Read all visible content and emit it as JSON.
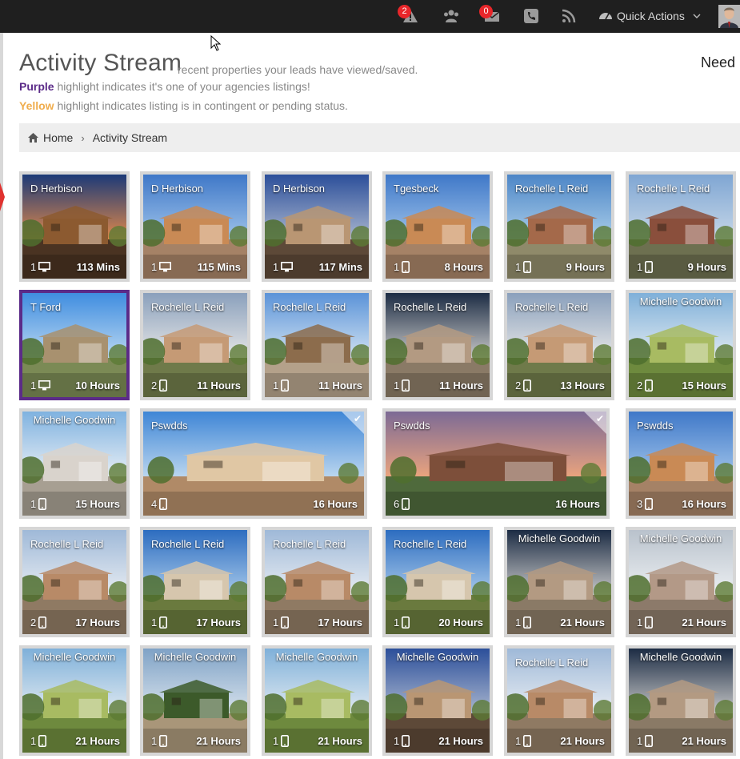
{
  "topbar": {
    "alerts_count": "2",
    "messages_count": "0",
    "quick_actions_label": "Quick Actions"
  },
  "header": {
    "title": "Activity Stream",
    "subtitle": "recent properties your leads have viewed/saved.",
    "need_label": "Need",
    "legend_purple_word": "Purple",
    "legend_purple_text": " highlight indicates it's one of your agencies listings!",
    "legend_yellow_word": "Yellow",
    "legend_yellow_text": " highlight indicates listing is in contingent or pending status.",
    "purple_color": "#5b2b88",
    "yellow_color": "#f0ad4e"
  },
  "breadcrumb": {
    "home": "Home",
    "current": "Activity Stream"
  },
  "tiles": [
    {
      "lead": "D Herbison",
      "count": "1",
      "device": "desktop-icon",
      "ago": "113 Mins",
      "scene": "dusk"
    },
    {
      "lead": "D Herbison",
      "count": "1",
      "device": "desktop-icon",
      "ago": "115 Mins",
      "scene": "adobe"
    },
    {
      "lead": "D Herbison",
      "count": "1",
      "device": "desktop-icon",
      "ago": "117 Mins",
      "scene": "dusk2"
    },
    {
      "lead": "Tgesbeck",
      "count": "1",
      "device": "mobile-icon",
      "ago": "8 Hours",
      "scene": "adobe"
    },
    {
      "lead": "Rochelle L Reid",
      "count": "1",
      "device": "mobile-icon",
      "ago": "9 Hours",
      "scene": "desert"
    },
    {
      "lead": "Rochelle L Reid",
      "count": "1",
      "device": "mobile-icon",
      "ago": "9 Hours",
      "scene": "brick"
    },
    {
      "lead": "T Ford",
      "count": "1",
      "device": "desktop-icon",
      "ago": "10 Hours",
      "scene": "aerial",
      "agency": true
    },
    {
      "lead": "Rochelle L Reid",
      "count": "2",
      "device": "mobile-icon",
      "ago": "11 Hours",
      "scene": "cloudy"
    },
    {
      "lead": "Rochelle L Reid",
      "count": "1",
      "device": "mobile-icon",
      "ago": "11 Hours",
      "scene": "patio"
    },
    {
      "lead": "Rochelle L Reid",
      "count": "1",
      "device": "mobile-icon",
      "ago": "11 Hours",
      "scene": "garage"
    },
    {
      "lead": "Rochelle L Reid",
      "count": "2",
      "device": "mobile-icon",
      "ago": "13 Hours",
      "scene": "cloudy"
    },
    {
      "lead": "Michelle Goodwin",
      "count": "2",
      "device": "mobile-icon",
      "ago": "15 Hours",
      "scene": "trees"
    },
    {
      "lead": "Michelle Goodwin",
      "count": "1",
      "device": "mobile-icon",
      "ago": "15 Hours",
      "scene": "modern"
    },
    {
      "lead": "Pswdds",
      "count": "4",
      "device": "mobile-icon",
      "ago": "16 Hours",
      "scene": "stucco",
      "wide": true,
      "saved": true
    },
    {
      "lead": "Pswdds",
      "count": "6",
      "device": "mobile-icon",
      "ago": "16 Hours",
      "scene": "fountain",
      "wide": true,
      "saved": true
    },
    {
      "lead": "Pswdds",
      "count": "3",
      "device": "mobile-icon",
      "ago": "16 Hours",
      "scene": "adobe"
    },
    {
      "lead": "Rochelle L Reid",
      "count": "2",
      "device": "mobile-icon",
      "ago": "17 Hours",
      "scene": "twostory"
    },
    {
      "lead": "Rochelle L Reid",
      "count": "1",
      "device": "mobile-icon",
      "ago": "17 Hours",
      "scene": "palm"
    },
    {
      "lead": "Rochelle L Reid",
      "count": "1",
      "device": "mobile-icon",
      "ago": "17 Hours",
      "scene": "twostory"
    },
    {
      "lead": "Rochelle L Reid",
      "count": "1",
      "device": "mobile-icon",
      "ago": "20 Hours",
      "scene": "palm"
    },
    {
      "lead": "Michelle Goodwin",
      "count": "1",
      "device": "mobile-icon",
      "ago": "21 Hours",
      "scene": "garage"
    },
    {
      "lead": "Michelle Goodwin",
      "count": "1",
      "device": "mobile-icon",
      "ago": "21 Hours",
      "scene": "overcast"
    },
    {
      "lead": "Michelle Goodwin",
      "count": "1",
      "device": "mobile-icon",
      "ago": "21 Hours",
      "scene": "trees"
    },
    {
      "lead": "Michelle Goodwin",
      "count": "1",
      "device": "mobile-icon",
      "ago": "21 Hours",
      "scene": "shade"
    },
    {
      "lead": "Michelle Goodwin",
      "count": "1",
      "device": "mobile-icon",
      "ago": "21 Hours",
      "scene": "trees"
    },
    {
      "lead": "Michelle Goodwin",
      "count": "1",
      "device": "mobile-icon",
      "ago": "21 Hours",
      "scene": "dusk2"
    },
    {
      "lead": "Rochelle L Reid",
      "count": "1",
      "device": "mobile-icon",
      "ago": "21 Hours",
      "scene": "twostory"
    },
    {
      "lead": "Michelle Goodwin",
      "count": "1",
      "device": "mobile-icon",
      "ago": "21 Hours",
      "scene": "garage"
    }
  ]
}
